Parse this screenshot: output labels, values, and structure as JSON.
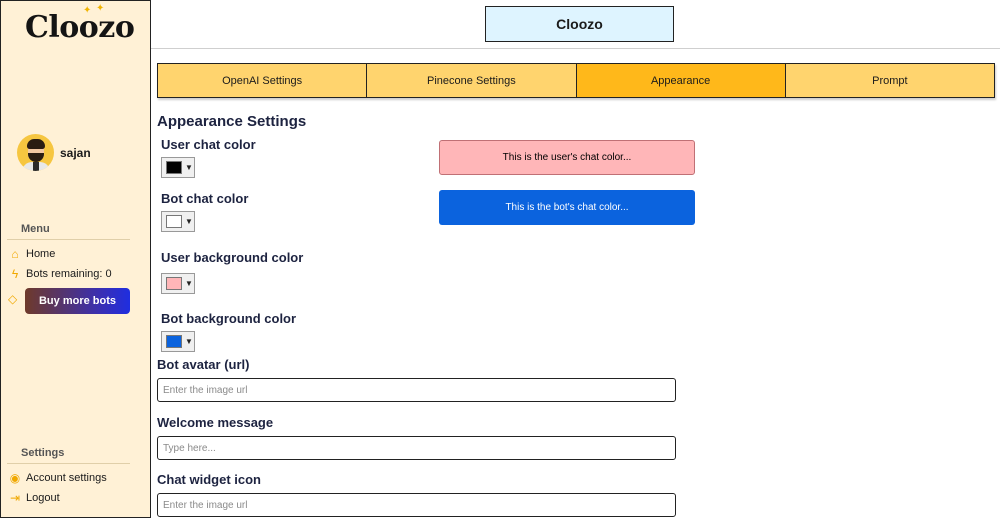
{
  "app": {
    "logo_text": "Cloozo",
    "title": "Cloozo"
  },
  "user": {
    "name": "sajan"
  },
  "sidebar": {
    "menu_label": "Menu",
    "items": [
      {
        "label": "Home",
        "icon": "home-icon"
      },
      {
        "label": "Bots remaining: 0",
        "icon": "lightning-icon"
      }
    ],
    "buy_button": "Buy more bots",
    "settings_label": "Settings",
    "settings_items": [
      {
        "label": "Account settings",
        "icon": "user-circle-icon"
      },
      {
        "label": "Logout",
        "icon": "logout-icon"
      }
    ]
  },
  "tabs": [
    {
      "label": "OpenAI Settings",
      "active": false
    },
    {
      "label": "Pinecone Settings",
      "active": false
    },
    {
      "label": "Appearance",
      "active": true
    },
    {
      "label": "Prompt",
      "active": false
    }
  ],
  "appearance": {
    "heading": "Appearance Settings",
    "user_chat_color": {
      "label": "User chat color",
      "value": "#000000"
    },
    "bot_chat_color": {
      "label": "Bot chat color",
      "value": "#ffffff"
    },
    "user_background_color": {
      "label": "User background color",
      "value": "#ffb6b8"
    },
    "bot_background_color": {
      "label": "Bot background color",
      "value": "#0b63de"
    },
    "user_preview": "This is the user's chat color...",
    "bot_preview": "This is the bot's chat color...",
    "bot_avatar": {
      "label": "Bot avatar (url)",
      "placeholder": "Enter the image url",
      "value": ""
    },
    "welcome_message": {
      "label": "Welcome message",
      "placeholder": "Type here...",
      "value": ""
    },
    "chat_widget_icon": {
      "label": "Chat widget icon",
      "placeholder": "Enter the image url",
      "value": ""
    }
  },
  "colors": {
    "sidebar_bg": "#fff1d6",
    "tab_bg": "#ffd46e",
    "tab_active_bg": "#ffb81a",
    "title_bg": "#def4ff",
    "accent": "#f0a800"
  }
}
